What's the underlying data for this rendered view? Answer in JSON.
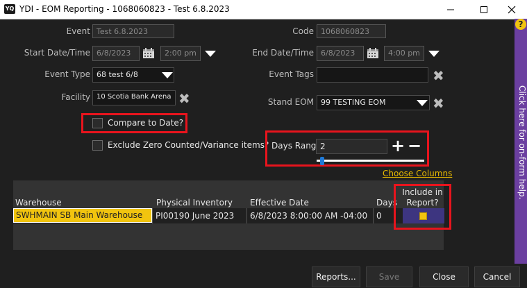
{
  "window": {
    "app_icon": "YQ",
    "title": "YDI - EOM Reporting - 1068060823 - Test 6.8.2023",
    "minimize_icon": "minimize-icon",
    "maximize_icon": "maximize-icon",
    "close_icon": "close-icon"
  },
  "form": {
    "event_label": "Event",
    "event_value": "Test 6.8.2023",
    "code_label": "Code",
    "code_value": "1068060823",
    "start_label": "Start Date/Time",
    "start_date": "6/8/2023",
    "start_time": "2:00 pm",
    "end_label": "End Date/Time",
    "end_date": "6/8/2023",
    "end_time": "4:00 pm",
    "event_type_label": "Event Type",
    "event_type_value": "68 test 6/8",
    "event_tags_label": "Event Tags",
    "event_tags_value": "",
    "facility_label": "Facility",
    "facility_value": "10 Scotia Bank Arena",
    "stand_eom_label": "Stand EOM",
    "stand_eom_value": "99 TESTING EOM",
    "compare_label": "Compare to Date?",
    "exclude_label": "Exclude Zero Counted/Variance items?",
    "days_range_label": "Days Range",
    "days_range_value": "2",
    "days_range_slider_fraction": 0.02,
    "plus_icon": "+",
    "minus_icon": "−",
    "choose_columns": "Choose Columns"
  },
  "help": {
    "icon": "?",
    "text": "Click here for on-form help."
  },
  "grid": {
    "columns": [
      "Warehouse",
      "Physical Inventory",
      "Effective Date",
      "Days",
      "Include in Report?"
    ],
    "rows": [
      {
        "warehouse": "SWHMAIN SB Main Warehouse",
        "physical_inventory": "PI00190 June 2023",
        "effective_date": "6/8/2023 8:00:00 AM -04:00",
        "days": "0",
        "include": true
      }
    ]
  },
  "buttons": {
    "reports": "Reports...",
    "save": "Save",
    "close": "Close",
    "cancel": "Cancel"
  },
  "colors": {
    "highlight_red": "#e8141d",
    "help_purple": "#6b3fa0",
    "accent_yellow": "#f1c40f",
    "link_yellow": "#e6b800"
  }
}
